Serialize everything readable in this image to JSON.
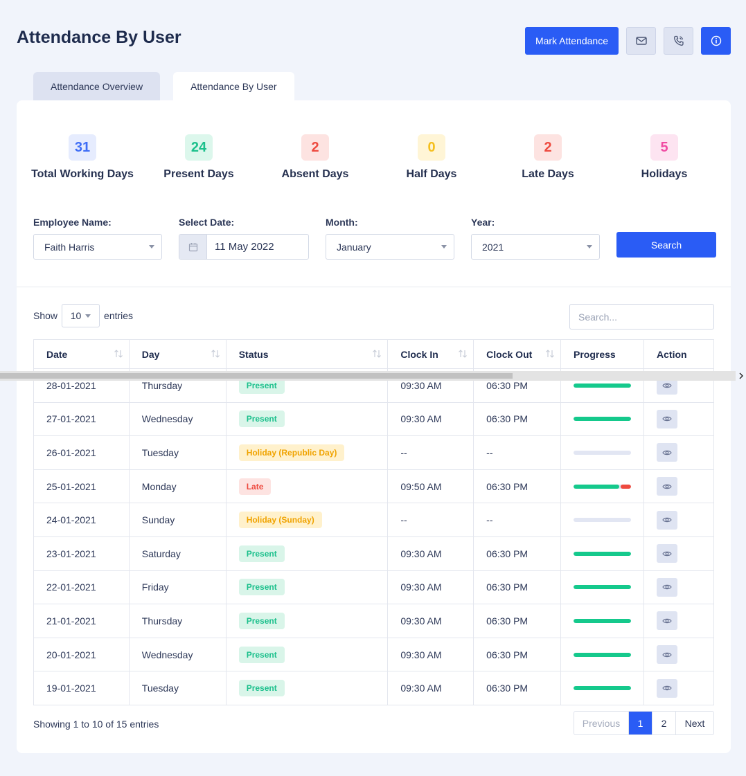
{
  "page": {
    "title": "Attendance By User"
  },
  "header": {
    "mark_attendance_label": "Mark Attendance",
    "icons": [
      "mail-icon",
      "phone-icon",
      "info-icon"
    ]
  },
  "tabs": [
    {
      "label": "Attendance Overview",
      "active": false
    },
    {
      "label": "Attendance By User",
      "active": true
    }
  ],
  "stats": [
    {
      "value": "31",
      "label": "Total Working Days",
      "color": "#3e6df6",
      "bg": "#e6ecfe"
    },
    {
      "value": "24",
      "label": "Present Days",
      "color": "#1cc08c",
      "bg": "#dcf7ec"
    },
    {
      "value": "2",
      "label": "Absent Days",
      "color": "#ee4a3f",
      "bg": "#fde3e1"
    },
    {
      "value": "0",
      "label": "Half Days",
      "color": "#f5bf1e",
      "bg": "#fff5d6"
    },
    {
      "value": "2",
      "label": "Late Days",
      "color": "#ee4a3f",
      "bg": "#fde3e1"
    },
    {
      "value": "5",
      "label": "Holidays",
      "color": "#f04ca3",
      "bg": "#fde4f1"
    }
  ],
  "filters": {
    "employee": {
      "label": "Employee Name:",
      "value": "Faith Harris"
    },
    "date": {
      "label": "Select Date:",
      "value": "11 May 2022"
    },
    "month": {
      "label": "Month:",
      "value": "January"
    },
    "year": {
      "label": "Year:",
      "value": "2021"
    },
    "search_label": "Search"
  },
  "table": {
    "show_label": "Show",
    "entries_label": "entries",
    "page_length": "10",
    "search_placeholder": "Search...",
    "columns": [
      "Date",
      "Day",
      "Status",
      "Clock In",
      "Clock Out",
      "Progress",
      "Action"
    ],
    "rows": [
      {
        "date": "28-01-2021",
        "day": "Thursday",
        "status": "Present",
        "status_type": "present",
        "clock_in": "09:30 AM",
        "clock_out": "06:30 PM",
        "progress": 1.0,
        "late_part": 0
      },
      {
        "date": "27-01-2021",
        "day": "Wednesday",
        "status": "Present",
        "status_type": "present",
        "clock_in": "09:30 AM",
        "clock_out": "06:30 PM",
        "progress": 1.0,
        "late_part": 0
      },
      {
        "date": "26-01-2021",
        "day": "Tuesday",
        "status": "Holiday (Republic Day)",
        "status_type": "holiday",
        "clock_in": "--",
        "clock_out": "--",
        "progress": 0,
        "late_part": 0
      },
      {
        "date": "25-01-2021",
        "day": "Monday",
        "status": "Late",
        "status_type": "late",
        "clock_in": "09:50 AM",
        "clock_out": "06:30 PM",
        "progress": 0.8,
        "late_part": 0.18
      },
      {
        "date": "24-01-2021",
        "day": "Sunday",
        "status": "Holiday (Sunday)",
        "status_type": "holiday",
        "clock_in": "--",
        "clock_out": "--",
        "progress": 0,
        "late_part": 0
      },
      {
        "date": "23-01-2021",
        "day": "Saturday",
        "status": "Present",
        "status_type": "present",
        "clock_in": "09:30 AM",
        "clock_out": "06:30 PM",
        "progress": 1.0,
        "late_part": 0
      },
      {
        "date": "22-01-2021",
        "day": "Friday",
        "status": "Present",
        "status_type": "present",
        "clock_in": "09:30 AM",
        "clock_out": "06:30 PM",
        "progress": 1.0,
        "late_part": 0
      },
      {
        "date": "21-01-2021",
        "day": "Thursday",
        "status": "Present",
        "status_type": "present",
        "clock_in": "09:30 AM",
        "clock_out": "06:30 PM",
        "progress": 1.0,
        "late_part": 0
      },
      {
        "date": "20-01-2021",
        "day": "Wednesday",
        "status": "Present",
        "status_type": "present",
        "clock_in": "09:30 AM",
        "clock_out": "06:30 PM",
        "progress": 1.0,
        "late_part": 0
      },
      {
        "date": "19-01-2021",
        "day": "Tuesday",
        "status": "Present",
        "status_type": "present",
        "clock_in": "09:30 AM",
        "clock_out": "06:30 PM",
        "progress": 1.0,
        "late_part": 0
      }
    ],
    "info": "Showing 1 to 10 of 15 entries",
    "pagination": {
      "previous": "Previous",
      "pages": [
        "1",
        "2"
      ],
      "active_page": "1",
      "next": "Next"
    }
  }
}
